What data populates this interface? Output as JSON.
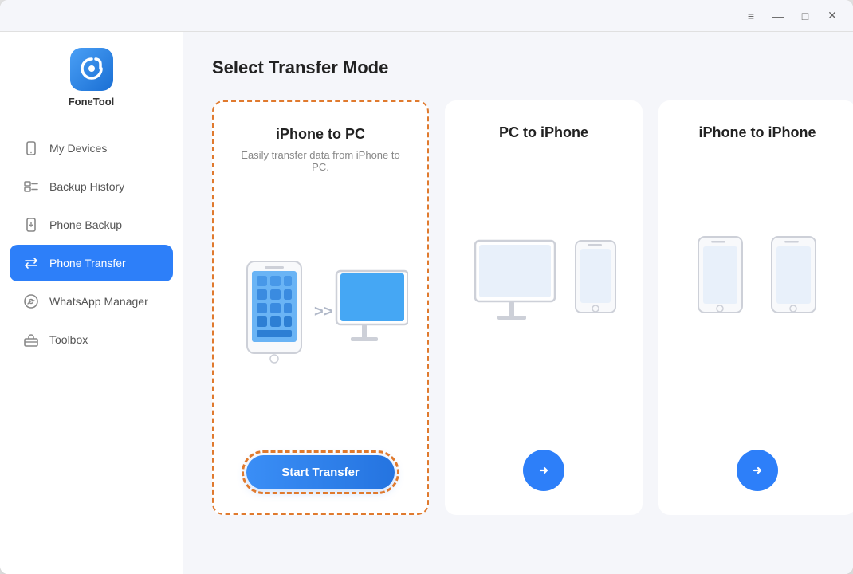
{
  "app": {
    "name": "FoneTool"
  },
  "titlebar": {
    "menu_icon": "≡",
    "minimize_icon": "—",
    "maximize_icon": "□",
    "close_icon": "✕"
  },
  "sidebar": {
    "items": [
      {
        "id": "my-devices",
        "label": "My Devices",
        "icon": "phone-icon",
        "active": false
      },
      {
        "id": "backup-history",
        "label": "Backup History",
        "icon": "backup-history-icon",
        "active": false
      },
      {
        "id": "phone-backup",
        "label": "Phone Backup",
        "icon": "phone-backup-icon",
        "active": false
      },
      {
        "id": "phone-transfer",
        "label": "Phone Transfer",
        "icon": "transfer-icon",
        "active": true
      },
      {
        "id": "whatsapp-manager",
        "label": "WhatsApp Manager",
        "icon": "whatsapp-icon",
        "active": false
      },
      {
        "id": "toolbox",
        "label": "Toolbox",
        "icon": "toolbox-icon",
        "active": false
      }
    ]
  },
  "main": {
    "page_title": "Select Transfer Mode",
    "cards": [
      {
        "id": "iphone-to-pc",
        "title": "iPhone to PC",
        "subtitle": "Easily transfer data from iPhone to PC.",
        "action_label": "Start Transfer",
        "selected": true
      },
      {
        "id": "pc-to-iphone",
        "title": "PC to iPhone",
        "subtitle": "",
        "action_label": "",
        "selected": false
      },
      {
        "id": "iphone-to-iphone",
        "title": "iPhone to iPhone",
        "subtitle": "",
        "action_label": "",
        "selected": false
      }
    ]
  }
}
